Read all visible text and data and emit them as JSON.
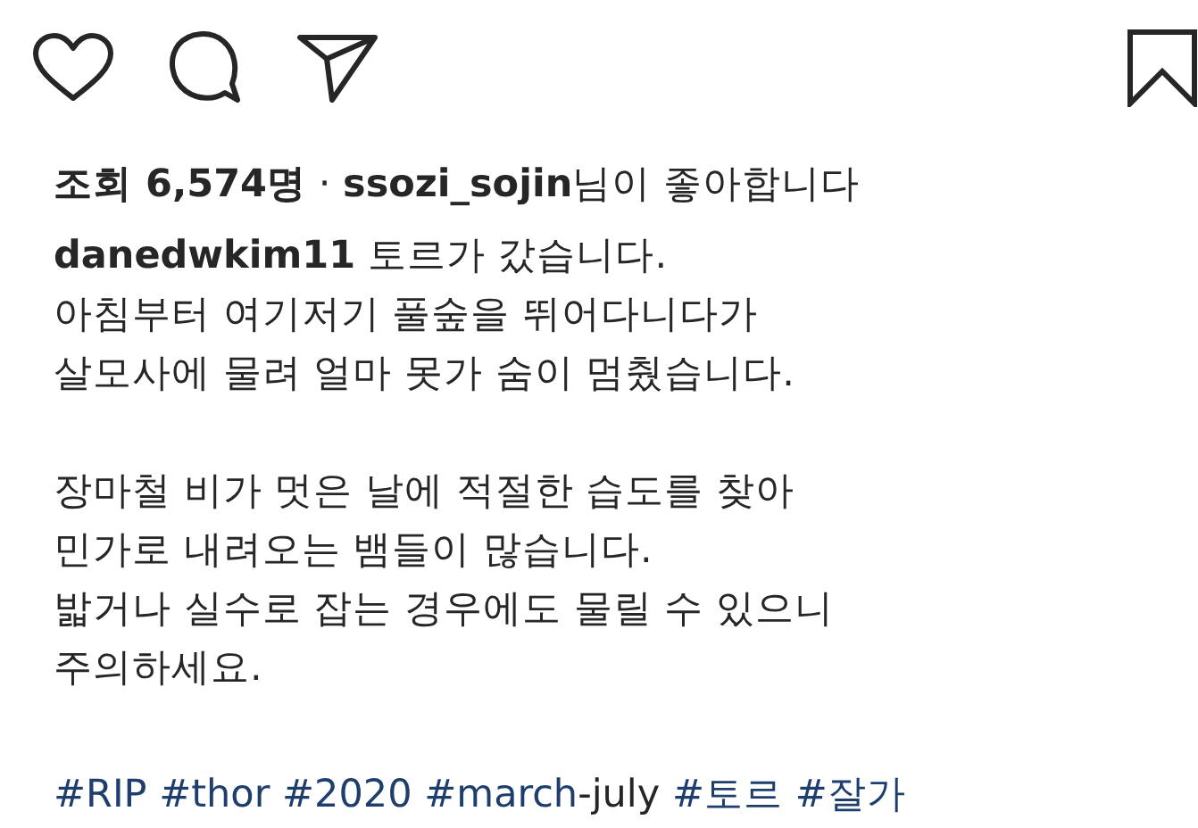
{
  "actions": [
    {
      "kind": "like"
    },
    {
      "kind": "comment"
    },
    {
      "kind": "share"
    }
  ],
  "bookmark": {
    "saved": false
  },
  "likes": "**조회 6,574명** · **ssozi_sojin**님이 좋아합니다",
  "caption": {
    "paragraphs": [
      "**danedwkim11** 토르가 갔습니다.\n아침부터 여기저기 풀숲을 뛰어다니다가\n살모사에 물려 얼마 못가 숨이 멈췄습니다.",
      "장마철 비가 멋은 날에 적절한 습도를 찾아\n민가로 내려오는 뱀들이 많습니다.\n밟거나 실수로 잡는 경우에도 물릴 수 있으니\n주의하세요."
    ],
    "hashtags": [
      {
        "tag": "#RIP"
      },
      {
        "tag": "#thor"
      },
      {
        "tag": "#2020"
      },
      {
        "tag": "#march",
        "rest": "-july"
      },
      {
        "tag": "#토르"
      },
      {
        "tag": "#잘가"
      }
    ]
  }
}
